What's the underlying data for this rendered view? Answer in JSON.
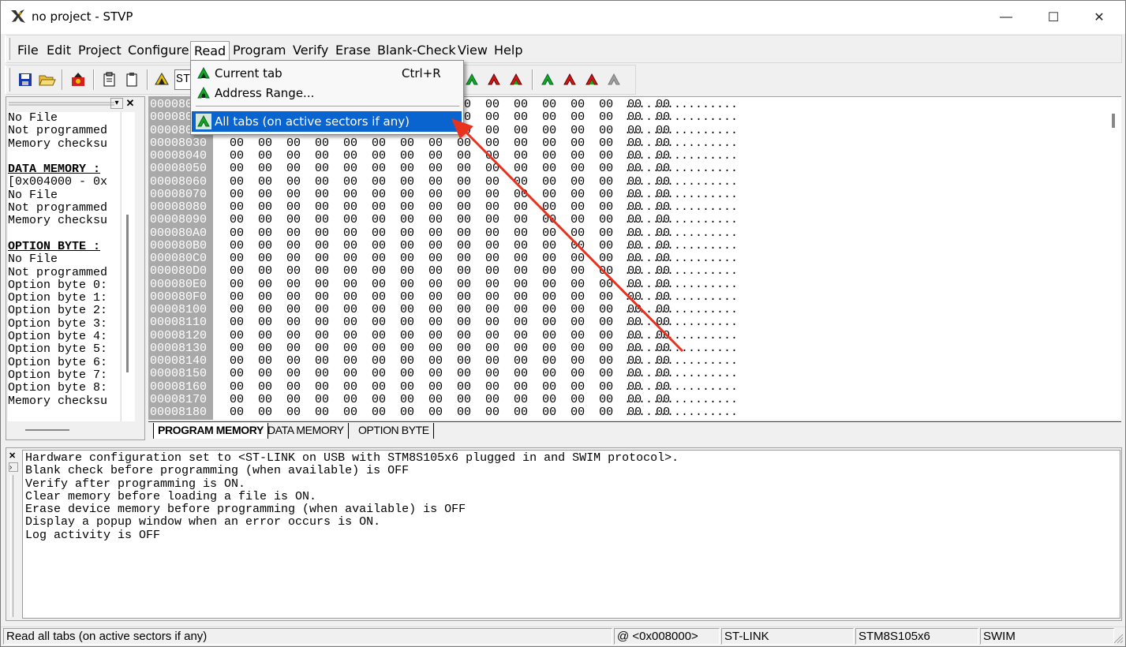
{
  "window": {
    "title": "no project - STVP",
    "minimize_glyph": "—",
    "maximize_glyph": "☐",
    "close_glyph": "✕"
  },
  "menu": {
    "file": "File",
    "edit": "Edit",
    "project": "Project",
    "configure": "Configure",
    "read": "Read",
    "program": "Program",
    "verify": "Verify",
    "erase": "Erase",
    "blank_check": "Blank-Check",
    "view": "View",
    "help": "Help"
  },
  "toolbar": {
    "device_combo_value": "ST"
  },
  "read_menu": {
    "current_tab": "Current tab",
    "current_tab_shortcut": "Ctrl+R",
    "address_range": "Address Range...",
    "all_tabs": "All tabs (on active sectors if any)"
  },
  "left_panel": {
    "lines": [
      {
        "text": "No File",
        "bold": false
      },
      {
        "text": "Not programmed",
        "bold": false
      },
      {
        "text": "Memory checksu",
        "bold": false
      },
      {
        "text": "",
        "bold": false
      },
      {
        "text": "DATA MEMORY :",
        "bold": true
      },
      {
        "text": "[0x004000 - 0x",
        "bold": false
      },
      {
        "text": "No File",
        "bold": false
      },
      {
        "text": "Not programmed",
        "bold": false
      },
      {
        "text": "Memory checksu",
        "bold": false
      },
      {
        "text": "",
        "bold": false
      },
      {
        "text": "OPTION BYTE :",
        "bold": true
      },
      {
        "text": "No File",
        "bold": false
      },
      {
        "text": "Not programmed",
        "bold": false
      },
      {
        "text": "Option byte 0:",
        "bold": false
      },
      {
        "text": "Option byte 1:",
        "bold": false
      },
      {
        "text": "Option byte 2:",
        "bold": false
      },
      {
        "text": "Option byte 3:",
        "bold": false
      },
      {
        "text": "Option byte 4:",
        "bold": false
      },
      {
        "text": "Option byte 5:",
        "bold": false
      },
      {
        "text": "Option byte 6:",
        "bold": false
      },
      {
        "text": "Option byte 7:",
        "bold": false
      },
      {
        "text": "Option byte 8:",
        "bold": false
      },
      {
        "text": "Memory checksu",
        "bold": false
      }
    ]
  },
  "memory": {
    "rows": [
      {
        "addr": "00008000",
        "hex": "00 00 00 00 00 00 00 00 00 00 00 00 00 00 00 00",
        "ascii": "................"
      },
      {
        "addr": "00008010",
        "hex": "00 00 00 00 00 00 00 00 00 00 00 00 00 00 00 00",
        "ascii": "................"
      },
      {
        "addr": "00008020",
        "hex": "00 00 00 00 00 00 00 00 00 00 00 00 00 00 00 00",
        "ascii": "................"
      },
      {
        "addr": "00008030",
        "hex": "00 00 00 00 00 00 00 00 00 00 00 00 00 00 00 00",
        "ascii": "................"
      },
      {
        "addr": "00008040",
        "hex": "00 00 00 00 00 00 00 00 00 00 00 00 00 00 00 00",
        "ascii": "................"
      },
      {
        "addr": "00008050",
        "hex": "00 00 00 00 00 00 00 00 00 00 00 00 00 00 00 00",
        "ascii": "................"
      },
      {
        "addr": "00008060",
        "hex": "00 00 00 00 00 00 00 00 00 00 00 00 00 00 00 00",
        "ascii": "................"
      },
      {
        "addr": "00008070",
        "hex": "00 00 00 00 00 00 00 00 00 00 00 00 00 00 00 00",
        "ascii": "................"
      },
      {
        "addr": "00008080",
        "hex": "00 00 00 00 00 00 00 00 00 00 00 00 00 00 00 00",
        "ascii": "................"
      },
      {
        "addr": "00008090",
        "hex": "00 00 00 00 00 00 00 00 00 00 00 00 00 00 00 00",
        "ascii": "................"
      },
      {
        "addr": "000080A0",
        "hex": "00 00 00 00 00 00 00 00 00 00 00 00 00 00 00 00",
        "ascii": "................"
      },
      {
        "addr": "000080B0",
        "hex": "00 00 00 00 00 00 00 00 00 00 00 00 00 00 00 00",
        "ascii": "................"
      },
      {
        "addr": "000080C0",
        "hex": "00 00 00 00 00 00 00 00 00 00 00 00 00 00 00 00",
        "ascii": "................"
      },
      {
        "addr": "000080D0",
        "hex": "00 00 00 00 00 00 00 00 00 00 00 00 00 00 00 00",
        "ascii": "................"
      },
      {
        "addr": "000080E0",
        "hex": "00 00 00 00 00 00 00 00 00 00 00 00 00 00 00 00",
        "ascii": "................"
      },
      {
        "addr": "000080F0",
        "hex": "00 00 00 00 00 00 00 00 00 00 00 00 00 00 00 00",
        "ascii": "................"
      },
      {
        "addr": "00008100",
        "hex": "00 00 00 00 00 00 00 00 00 00 00 00 00 00 00 00",
        "ascii": "................"
      },
      {
        "addr": "00008110",
        "hex": "00 00 00 00 00 00 00 00 00 00 00 00 00 00 00 00",
        "ascii": "................"
      },
      {
        "addr": "00008120",
        "hex": "00 00 00 00 00 00 00 00 00 00 00 00 00 00 00 00",
        "ascii": "................"
      },
      {
        "addr": "00008130",
        "hex": "00 00 00 00 00 00 00 00 00 00 00 00 00 00 00 00",
        "ascii": "................"
      },
      {
        "addr": "00008140",
        "hex": "00 00 00 00 00 00 00 00 00 00 00 00 00 00 00 00",
        "ascii": "................"
      },
      {
        "addr": "00008150",
        "hex": "00 00 00 00 00 00 00 00 00 00 00 00 00 00 00 00",
        "ascii": "................"
      },
      {
        "addr": "00008160",
        "hex": "00 00 00 00 00 00 00 00 00 00 00 00 00 00 00 00",
        "ascii": "................"
      },
      {
        "addr": "00008170",
        "hex": "00 00 00 00 00 00 00 00 00 00 00 00 00 00 00 00",
        "ascii": "................"
      },
      {
        "addr": "00008180",
        "hex": "00 00 00 00 00 00 00 00 00 00 00 00 00 00 00 00",
        "ascii": "................"
      }
    ]
  },
  "tabs": {
    "program_memory": "PROGRAM MEMORY",
    "data_memory": "DATA MEMORY",
    "option_byte": "OPTION BYTE"
  },
  "log": {
    "lines": [
      "Hardware configuration set to <ST-LINK on USB with STM8S105x6 plugged in and SWIM protocol>.",
      "Blank check before programming (when available) is OFF",
      "Verify after programming is ON.",
      "Clear memory before loading a file is ON.",
      "Erase device memory before programming (when available) is OFF",
      "Display a popup window when an error occurs is ON.",
      "Log activity is OFF"
    ]
  },
  "statusbar": {
    "message": "Read all tabs (on active sectors if any)",
    "address": "@ <0x008000>",
    "programmer": "ST-LINK",
    "device": "STM8S105x6",
    "protocol": "SWIM"
  },
  "colors": {
    "highlight": "#0a64d0",
    "annotation_arrow": "#e8321e",
    "address_column": "#a9a9a9",
    "read_icon_green": "#18a818",
    "program_icon_red": "#d01818"
  }
}
